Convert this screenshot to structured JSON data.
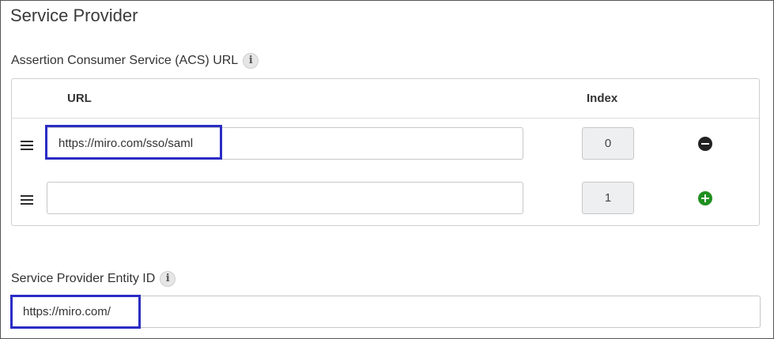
{
  "section": {
    "title": "Service Provider"
  },
  "acs": {
    "label": "Assertion Consumer Service (ACS) URL",
    "info_glyph": "i",
    "columns": {
      "url": "URL",
      "index": "Index"
    },
    "rows": [
      {
        "url": "https://miro.com/sso/saml",
        "index": "0",
        "action": "remove"
      },
      {
        "url": "",
        "index": "1",
        "action": "add"
      }
    ]
  },
  "entity": {
    "label": "Service Provider Entity ID",
    "info_glyph": "i",
    "value": "https://miro.com/"
  },
  "colors": {
    "highlight": "#2a2cc4",
    "remove_button": "#222222",
    "add_button": "#1f8f1f"
  },
  "icons": {
    "info": "info-icon",
    "drag": "drag-handle-icon",
    "remove": "minus-circle-icon",
    "add": "plus-circle-icon"
  }
}
